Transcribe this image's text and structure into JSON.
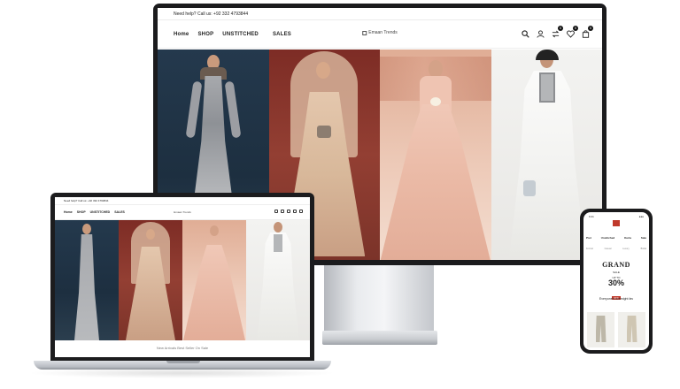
{
  "desktop": {
    "topbar_text": "Need help? Call us: +92 332 4793844",
    "nav_links": [
      "Home",
      "SHOP",
      "UNSTITCHED",
      "SALES"
    ],
    "logo_text": "Emaan Trends",
    "icons": [
      "search-icon",
      "user-icon",
      "compare-icon",
      "wishlist-icon",
      "cart-icon"
    ],
    "badges": {
      "compare": "0",
      "wishlist": "0",
      "cart": "0"
    }
  },
  "laptop": {
    "topbar_text": "Need help? Call us: +92 332 4793844",
    "nav_links": [
      "Home",
      "SHOP",
      "UNSTITCHED",
      "SALES"
    ],
    "logo_text": "Emaan Trends",
    "section_text": "New Arrivals    Best Seller    On Sale"
  },
  "phone": {
    "status_left": "9:41",
    "status_right": "●●●",
    "categories": [
      "Pret",
      "Unstitched",
      "Kurta",
      "Sale"
    ],
    "categories_sub": [
      "Formal",
      "Casual",
      "Luxury",
      "Bridal"
    ],
    "banner_title": "GRAND",
    "banner_sub": "SALE",
    "banner_upto": "UP TO",
    "banner_pct": "30%",
    "banner_off": "OFF",
    "fav_heading": "Everyone's overnight fav"
  }
}
